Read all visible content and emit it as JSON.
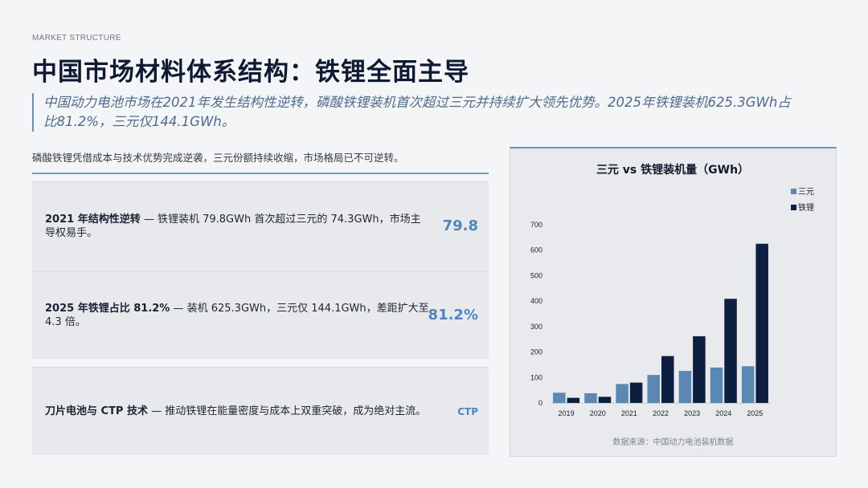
{
  "eyebrow": "MARKET STRUCTURE",
  "title": "中国市场材料体系结构：铁锂全面主导",
  "lede": "中国动力电池市场在2021年发生结构性逆转，磷酸铁锂装机首次超过三元并持续扩大领先优势。2025年铁锂装机625.3GWh占比81.2%，三元仅144.1GWh。",
  "summary": "磷酸铁锂凭借成本与技术优势完成逆袭，三元份额持续收缩，市场格局已不可逆转。",
  "cards": [
    {
      "lead": "2021 年结构性逆转",
      "dash": " — ",
      "body": "铁锂装机 79.8GWh 首次超过三元的 74.3GWh，市场主导权易手。",
      "metric": "79.8"
    },
    {
      "lead": "2025 年铁锂占比 81.2%",
      "dash": " — ",
      "body": "装机 625.3GWh，三元仅 144.1GWh，差距扩大至4.3 倍。",
      "metric": "81.2%"
    },
    {
      "lead": "刀片电池与 CTP 技术",
      "dash": " — ",
      "body": "推动铁锂在能量密度与成本上双重突破，成为绝对主流。",
      "metric": "CTP"
    }
  ],
  "source": "数据来源：中国动力电池装机数据",
  "colors": {
    "ternary": "#5b87b5",
    "lfp": "#0d1f3f"
  },
  "chart_data": {
    "type": "bar",
    "title": "三元 vs 铁锂装机量（GWh）",
    "categories": [
      "2019",
      "2020",
      "2021",
      "2022",
      "2023",
      "2024",
      "2025"
    ],
    "series": [
      {
        "name": "三元",
        "values": [
          40,
          38,
          74.3,
          110,
          126,
          139,
          144.1
        ]
      },
      {
        "name": "铁锂",
        "values": [
          20,
          24,
          79.8,
          184,
          262,
          409,
          625.3
        ]
      }
    ],
    "ylim": [
      0,
      700
    ],
    "yticks": [
      0,
      100,
      200,
      300,
      400,
      500,
      600,
      700
    ],
    "legend": "top-right",
    "grid": false
  }
}
